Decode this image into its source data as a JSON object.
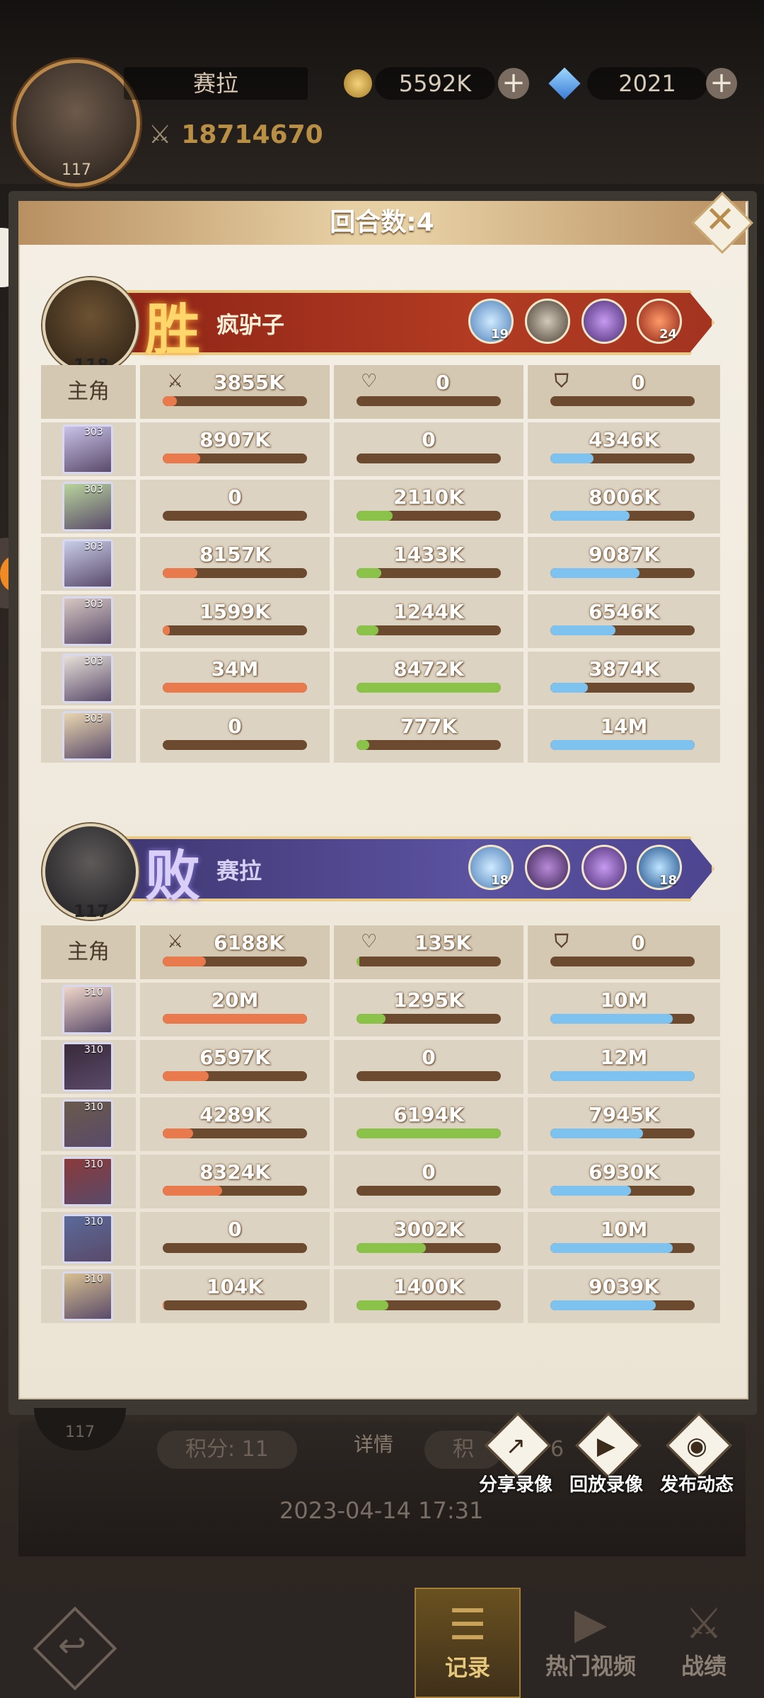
{
  "header": {
    "player_name": "赛拉",
    "player_level": "117",
    "gold": "5592K",
    "gems": "2021",
    "power": "18714670"
  },
  "modal": {
    "title": "回合数:4",
    "lead_label": "主角",
    "winner": {
      "result": "胜",
      "name": "疯驴子",
      "level": "118",
      "skills": [
        {
          "icon": "ice-crystal-skill-icon",
          "count": "19"
        },
        {
          "icon": "gear-skill-icon",
          "count": ""
        },
        {
          "icon": "helmet-skill-icon",
          "count": ""
        },
        {
          "icon": "fire-skill-icon",
          "count": "24"
        }
      ],
      "lead": {
        "damage": "3855K",
        "damage_fill": 0.1,
        "heal": "0",
        "heal_fill": 0,
        "defense": "0",
        "defense_fill": 0
      },
      "heroes": [
        {
          "level": "303",
          "damage": "8907K",
          "damage_fill": 0.26,
          "heal": "0",
          "heal_fill": 0,
          "defense": "4346K",
          "defense_fill": 0.3
        },
        {
          "level": "303",
          "damage": "0",
          "damage_fill": 0,
          "heal": "2110K",
          "heal_fill": 0.25,
          "defense": "8006K",
          "defense_fill": 0.55
        },
        {
          "level": "303",
          "damage": "8157K",
          "damage_fill": 0.24,
          "heal": "1433K",
          "heal_fill": 0.17,
          "defense": "9087K",
          "defense_fill": 0.62
        },
        {
          "level": "303",
          "damage": "1599K",
          "damage_fill": 0.05,
          "heal": "1244K",
          "heal_fill": 0.15,
          "defense": "6546K",
          "defense_fill": 0.45
        },
        {
          "level": "303",
          "damage": "34M",
          "damage_fill": 1.0,
          "heal": "8472K",
          "heal_fill": 1.0,
          "defense": "3874K",
          "defense_fill": 0.26
        },
        {
          "level": "303",
          "damage": "0",
          "damage_fill": 0,
          "heal": "777K",
          "heal_fill": 0.09,
          "defense": "14M",
          "defense_fill": 1.0
        }
      ]
    },
    "loser": {
      "result": "败",
      "name": "赛拉",
      "level": "117",
      "skills": [
        {
          "icon": "ice-crystal-skill-icon",
          "count": "18"
        },
        {
          "icon": "demon-skill-icon",
          "count": ""
        },
        {
          "icon": "helmet-skill-icon",
          "count": ""
        },
        {
          "icon": "blue-swirl-skill-icon",
          "count": "18"
        }
      ],
      "lead": {
        "damage": "6188K",
        "damage_fill": 0.3,
        "heal": "135K",
        "heal_fill": 0.02,
        "defense": "0",
        "defense_fill": 0
      },
      "heroes": [
        {
          "level": "310",
          "damage": "20M",
          "damage_fill": 1.0,
          "heal": "1295K",
          "heal_fill": 0.2,
          "defense": "10M",
          "defense_fill": 0.85
        },
        {
          "level": "310",
          "damage": "6597K",
          "damage_fill": 0.32,
          "heal": "0",
          "heal_fill": 0,
          "defense": "12M",
          "defense_fill": 1.0
        },
        {
          "level": "310",
          "damage": "4289K",
          "damage_fill": 0.21,
          "heal": "6194K",
          "heal_fill": 1.0,
          "defense": "7945K",
          "defense_fill": 0.64
        },
        {
          "level": "310",
          "damage": "8324K",
          "damage_fill": 0.41,
          "heal": "0",
          "heal_fill": 0,
          "defense": "6930K",
          "defense_fill": 0.56
        },
        {
          "level": "310",
          "damage": "0",
          "damage_fill": 0,
          "heal": "3002K",
          "heal_fill": 0.48,
          "defense": "10M",
          "defense_fill": 0.85
        },
        {
          "level": "310",
          "damage": "104K",
          "damage_fill": 0.01,
          "heal": "1400K",
          "heal_fill": 0.22,
          "defense": "9039K",
          "defense_fill": 0.73
        }
      ]
    }
  },
  "footer": {
    "score_left": "积分: 11",
    "score_right": "积",
    "score_right_num": "6",
    "detail": "详情",
    "date": "2023-04-14 17:31",
    "left_level": "117",
    "actions": [
      "分享录像",
      "回放录像",
      "发布动态"
    ]
  },
  "bottom_nav": {
    "record": "记录",
    "videos": "热门视频",
    "stats": "战绩"
  },
  "colors": {
    "win_banner": "#b23b22",
    "lose_banner": "#5b52a0",
    "damage_bar": "#e87a4e",
    "heal_bar": "#8bc34a",
    "defense_bar": "#7ec3ef"
  }
}
